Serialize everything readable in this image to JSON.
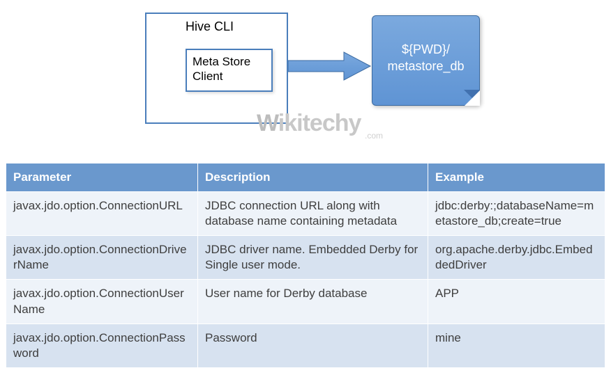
{
  "diagram": {
    "outer_label": "Hive CLI",
    "inner_label": "Meta Store Client",
    "target_label_line1": "${PWD}/",
    "target_label_line2": "metastore_db",
    "watermark": "Wikitechy",
    "watermark_sub": ".com",
    "arrow_color": "#5f94d4"
  },
  "table": {
    "headers": {
      "param": "Parameter",
      "desc": "Description",
      "ex": "Example"
    },
    "rows": [
      {
        "param": "javax.jdo.option.ConnectionURL",
        "desc": "JDBC connection URL along with database name containing metadata",
        "ex": "jdbc:derby:;databaseName=metastore_db;create=true"
      },
      {
        "param": "javax.jdo.option.ConnectionDriverName",
        "desc": "JDBC driver name. Embedded Derby for Single user mode.",
        "ex": "org.apache.derby.jdbc.EmbeddedDriver"
      },
      {
        "param": "javax.jdo.option.ConnectionUserName",
        "desc": "User name for Derby database",
        "ex": "APP"
      },
      {
        "param": "javax.jdo.option.ConnectionPassword",
        "desc": "Password",
        "ex": "mine"
      }
    ]
  }
}
